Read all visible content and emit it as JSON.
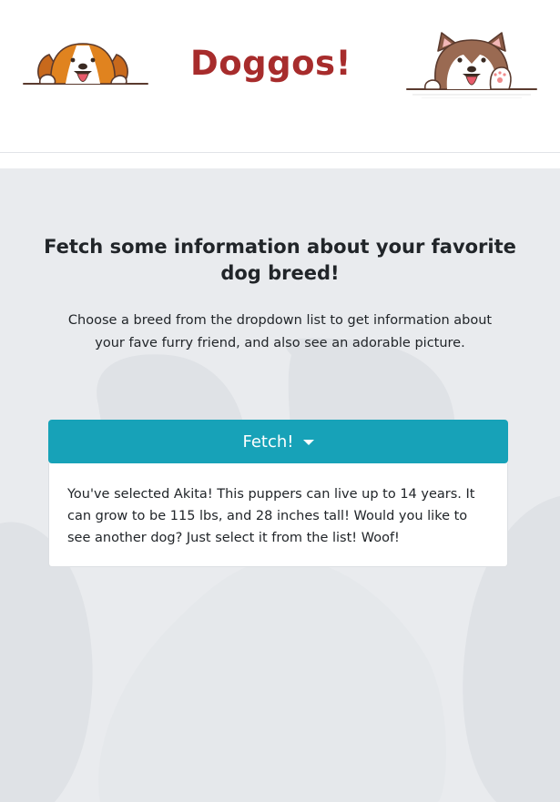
{
  "header": {
    "title": "Doggos!",
    "left_mascot_icon": "beagle-peeking-icon",
    "right_mascot_icon": "husky-peeking-icon"
  },
  "main": {
    "headline": "Fetch some information about your favorite dog breed!",
    "subtext": "Choose a breed from the dropdown list to get information about your fave furry friend, and also see an adorable picture.",
    "fetch_button_label": "Fetch!",
    "info_text": "You've selected Akita! This puppers can live up to 14 years. It can grow to be 115 lbs, and 28 inches tall! Would you like to see another dog? Just select it from the list! Woof!",
    "background_icon": "paw-print-icon"
  },
  "colors": {
    "title": "#a72c2c",
    "button": "#17a2b8",
    "main_background": "#e9ebee",
    "paw": "#dfe2e6"
  }
}
